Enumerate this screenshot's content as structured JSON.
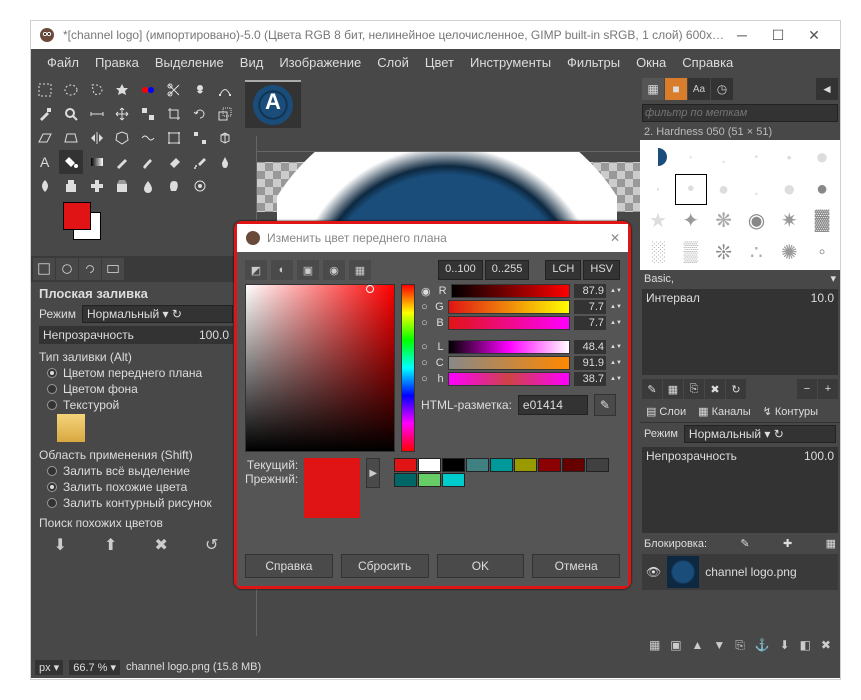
{
  "window": {
    "title": "*[channel logo] (импортировано)-5.0 (Цвета RGB 8 бит, нелинейное целочисленное, GIMP built-in sRGB, 1 слой) 600x60..."
  },
  "menubar": [
    "Файл",
    "Правка",
    "Выделение",
    "Вид",
    "Изображение",
    "Слой",
    "Цвет",
    "Инструменты",
    "Фильтры",
    "Окна",
    "Справка"
  ],
  "tool_options": {
    "title": "Плоская заливка",
    "mode_label": "Режим",
    "mode_value": "Нормальный",
    "opacity_label": "Непрозрачность",
    "opacity_value": "100.0",
    "fill_type_header": "Тип заливки (Alt)",
    "fill_fg": "Цветом переднего плана",
    "fill_bg": "Цветом фона",
    "fill_tex": "Текстурой",
    "area_header": "Область применения (Shift)",
    "area_all": "Залить всё выделение",
    "area_similar": "Залить похожие цвета",
    "area_outline": "Залить контурный рисунок",
    "similar_header": "Поиск похожих цветов"
  },
  "right_panel": {
    "filter_placeholder": "фильтр по меткам",
    "brush_label": "2. Hardness 050 (51 × 51)",
    "preset": "Basic,",
    "spacing_label": "Интервал",
    "spacing_value": "10.0",
    "layers_tab": "Слои",
    "channels_tab": "Каналы",
    "paths_tab": "Контуры",
    "mode_label": "Режим",
    "mode_value": "Нормальный",
    "opacity_label": "Непрозрачность",
    "opacity_value": "100.0",
    "lock_label": "Блокировка:",
    "layer_name": "channel logo.png"
  },
  "statusbar": {
    "unit": "px",
    "zoom": "66.7 %",
    "filename": "channel logo.png (15.8 MB)"
  },
  "color_dialog": {
    "title": "Изменить цвет переднего плана",
    "range_100": "0..100",
    "range_255": "0..255",
    "lch": "LCH",
    "hsv": "HSV",
    "channels": {
      "r": {
        "label": "R",
        "value": "87.9"
      },
      "g": {
        "label": "G",
        "value": "7.7"
      },
      "b": {
        "label": "B",
        "value": "7.7"
      },
      "l": {
        "label": "L",
        "value": "48.4"
      },
      "c": {
        "label": "C",
        "value": "91.9"
      },
      "h": {
        "label": "h",
        "value": "38.7"
      }
    },
    "html_label": "HTML-разметка:",
    "html_value": "e01414",
    "current_label": "Текущий:",
    "previous_label": "Прежний:",
    "palette": [
      "#e01414",
      "#ffffff",
      "#000000",
      "#408080",
      "#009999",
      "#999900",
      "#8b0000",
      "#660000",
      "#404040",
      "#006666",
      "#66cc66",
      "#00cccc"
    ],
    "btn_help": "Справка",
    "btn_reset": "Сбросить",
    "btn_ok": "OK",
    "btn_cancel": "Отмена"
  }
}
